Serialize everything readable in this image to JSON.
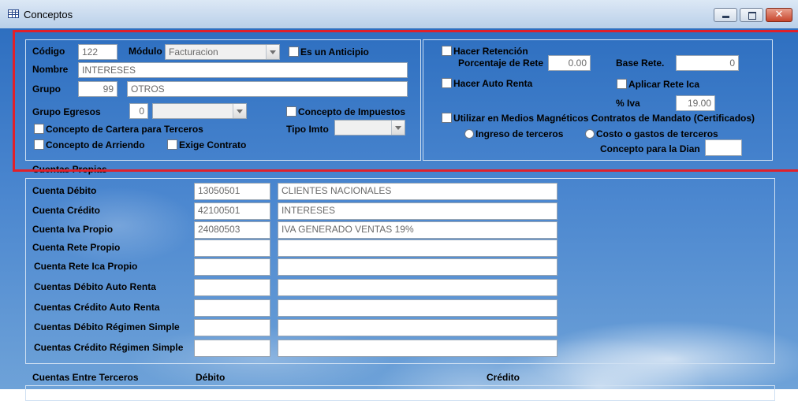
{
  "window": {
    "title": "Conceptos",
    "close_glyph": "✕"
  },
  "general": {
    "codigo_label": "Código",
    "codigo_value": "122",
    "modulo_label": "Módulo",
    "modulo_value": "Facturacion",
    "anticipo_label": "Es un Anticipio",
    "nombre_label": "Nombre",
    "nombre_value": "INTERESES",
    "grupo_label": "Grupo",
    "grupo_code": "99",
    "grupo_name": "OTROS",
    "grupo_egresos_label": "Grupo Egresos",
    "grupo_egresos_value": "0",
    "concepto_impuestos_label": "Concepto de Impuestos",
    "cartera_terceros_label": "Concepto de Cartera para Terceros",
    "tipo_imto_label": "Tipo Imto",
    "arriendo_label": "Concepto de Arriendo",
    "exige_contrato_label": "Exige Contrato"
  },
  "retencion": {
    "hacer_retencion_label": "Hacer Retención",
    "porcentaje_rete_label": "Porcentaje de Rete",
    "porcentaje_rete_value": "0.00",
    "base_rete_label": "Base Rete.",
    "base_rete_value": "0",
    "hacer_auto_renta_label": "Hacer Auto Renta",
    "aplicar_rete_ica_label": "Aplicar Rete Ica",
    "iva_label": "% Iva",
    "iva_value": "19.00",
    "medios_magneticos_label": "Utilizar en Medios Magnéticos Contratos de Mandato (Certificados)",
    "ingreso_terceros_label": "Ingreso de terceros",
    "costo_gastos_label": "Costo o gastos de terceros",
    "concepto_dian_label": "Concepto para la Dian",
    "concepto_dian_value": ""
  },
  "cuentas_propias": {
    "title": "Cuentas Propias",
    "rows": [
      {
        "label": "Cuenta Débito",
        "code": "13050501",
        "name": "CLIENTES NACIONALES"
      },
      {
        "label": "Cuenta Crédito",
        "code": "42100501",
        "name": "INTERESES"
      },
      {
        "label": "Cuenta Iva Propio",
        "code": "24080503",
        "name": "IVA GENERADO VENTAS 19%"
      },
      {
        "label": "Cuenta Rete Propio",
        "code": "",
        "name": ""
      },
      {
        "label": "Cuenta Rete Ica Propio",
        "code": "",
        "name": ""
      },
      {
        "label": "Cuentas Débito Auto Renta",
        "code": "",
        "name": ""
      },
      {
        "label": "Cuentas Crédito Auto Renta",
        "code": "",
        "name": ""
      },
      {
        "label": "Cuentas Débito Régimen Simple",
        "code": "",
        "name": ""
      },
      {
        "label": "Cuentas Crédito Régimen Simple",
        "code": "",
        "name": ""
      }
    ]
  },
  "cuentas_terceros": {
    "title": "Cuentas Entre Terceros",
    "debito_label": "Débito",
    "credito_label": "Crédito"
  },
  "colors": {
    "highlight_frame": "#e0202a",
    "background": "#4a86cf"
  }
}
